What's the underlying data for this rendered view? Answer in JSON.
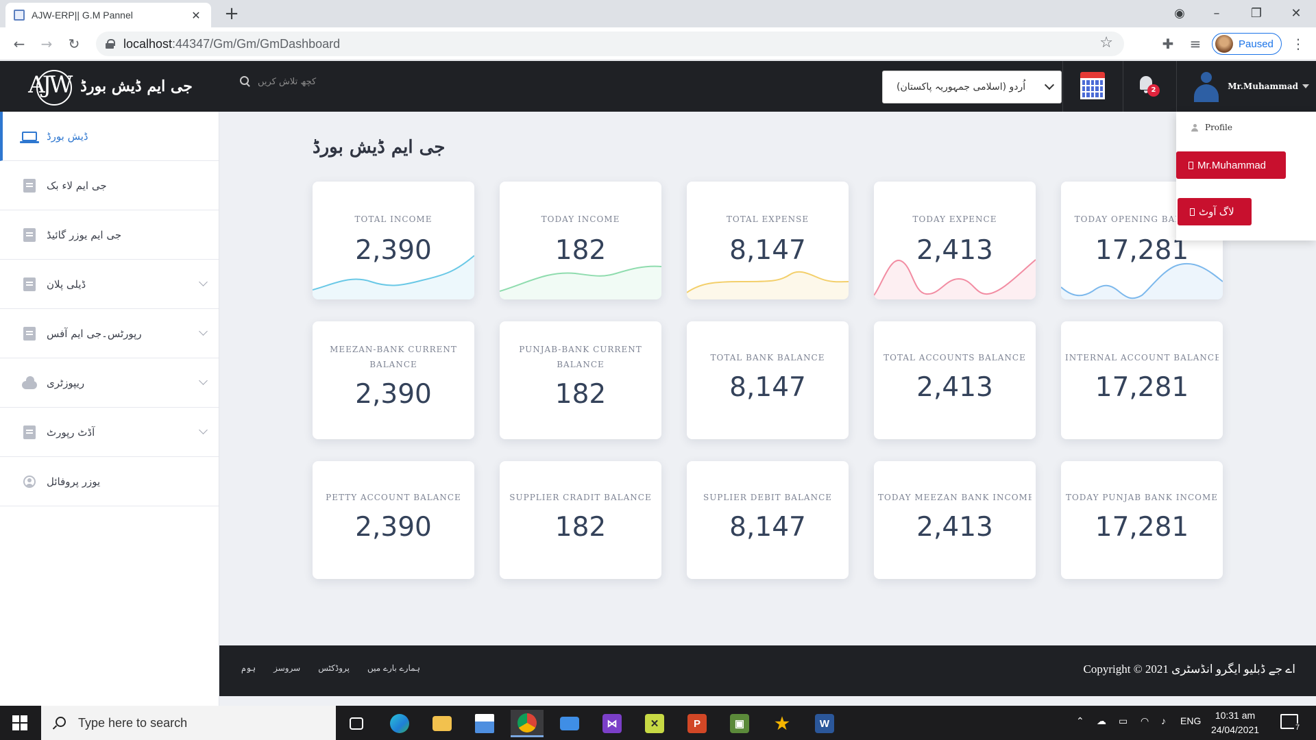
{
  "browser": {
    "tab_title": "AJW-ERP|| G.M Pannel",
    "url_host": "localhost",
    "url_path": ":44347/Gm/Gm/GmDashboard",
    "profile_status": "Paused"
  },
  "header": {
    "brand_logo": "AJW",
    "brand_title": "جی ایم ڈیش بورڈ",
    "search_placeholder": "کچھ تلاش کریں",
    "language_selected": "اُردو (اسلامی جمہوریہ پاکستان)",
    "notification_count": "2",
    "user_name": "Mr.Muhammad"
  },
  "user_menu": {
    "profile_label": "Profile",
    "user_button_label": "Mr.Muhammad",
    "logout_label": "لاگ آوٹ"
  },
  "sidebar": {
    "items": [
      {
        "label": "ڈیش بورڈ",
        "icon": "laptop-icon"
      },
      {
        "label": "جی ایم لاء بک",
        "icon": "document-icon"
      },
      {
        "label": "جی ایم یوزر گائیڈ",
        "icon": "document-icon"
      },
      {
        "label": "ڈیلی پلان",
        "icon": "document-icon"
      },
      {
        "label": "رپورٹس۔جی ایم آفس",
        "icon": "document-icon"
      },
      {
        "label": "ریپوزٹری",
        "icon": "cloud-icon"
      },
      {
        "label": "آڈٹ رپورٹ",
        "icon": "document-icon"
      },
      {
        "label": "یوزر پروفائل",
        "icon": "user-icon"
      }
    ]
  },
  "page": {
    "title": "جی ایم ڈیش بورڈ"
  },
  "cards": [
    {
      "label": "TOTAL INCOME",
      "value": "2,390",
      "spark_color": "#69c8e6"
    },
    {
      "label": "TODAY INCOME",
      "value": "182",
      "spark_color": "#8fdcae"
    },
    {
      "label": "TOTAL EXPENSE",
      "value": "8,147",
      "spark_color": "#f3cf6a"
    },
    {
      "label": "TODAY EXPENCE",
      "value": "2,413",
      "spark_color": "#f28ca2"
    },
    {
      "label": "TODAY OPENING BALANCE",
      "value": "17,281",
      "spark_color": "#7cb8ec"
    },
    {
      "label": "MEEZAN-BANK CURRENT BALANCE",
      "value": "2,390"
    },
    {
      "label": "PUNJAB-BANK CURRENT BALANCE",
      "value": "182"
    },
    {
      "label": "TOTAL BANK BALANCE",
      "value": "8,147"
    },
    {
      "label": "TOTAL ACCOUNTS BALANCE",
      "value": "2,413"
    },
    {
      "label": "INTERNAL ACCOUNT BALANCE",
      "value": "17,281"
    },
    {
      "label": "PETTY ACCOUNT BALANCE",
      "value": "2,390"
    },
    {
      "label": "SUPPLIER CRADIT BALANCE",
      "value": "182"
    },
    {
      "label": "SUPLIER DEBIT BALANCE",
      "value": "8,147"
    },
    {
      "label": "TODAY MEEZAN BANK INCOME",
      "value": "2,413"
    },
    {
      "label": "TODAY PUNJAB BANK INCOME",
      "value": "17,281"
    }
  ],
  "footer": {
    "links": [
      "ہوم",
      "سروسز",
      "پروڈکٹس",
      "ہمارے بارے میں"
    ],
    "copyright": "Copyright © 2021 اے جے ڈبلیو ایگرو انڈسٹری"
  },
  "taskbar": {
    "search_placeholder": "Type here to search",
    "language": "ENG",
    "time": "10:31 am",
    "date": "24/04/2021",
    "notification_count": "7"
  },
  "colors": {
    "header_bg": "#1f2125",
    "accent_blue": "#2e77d0",
    "danger_red": "#c8102e",
    "value_text": "#34425a"
  }
}
